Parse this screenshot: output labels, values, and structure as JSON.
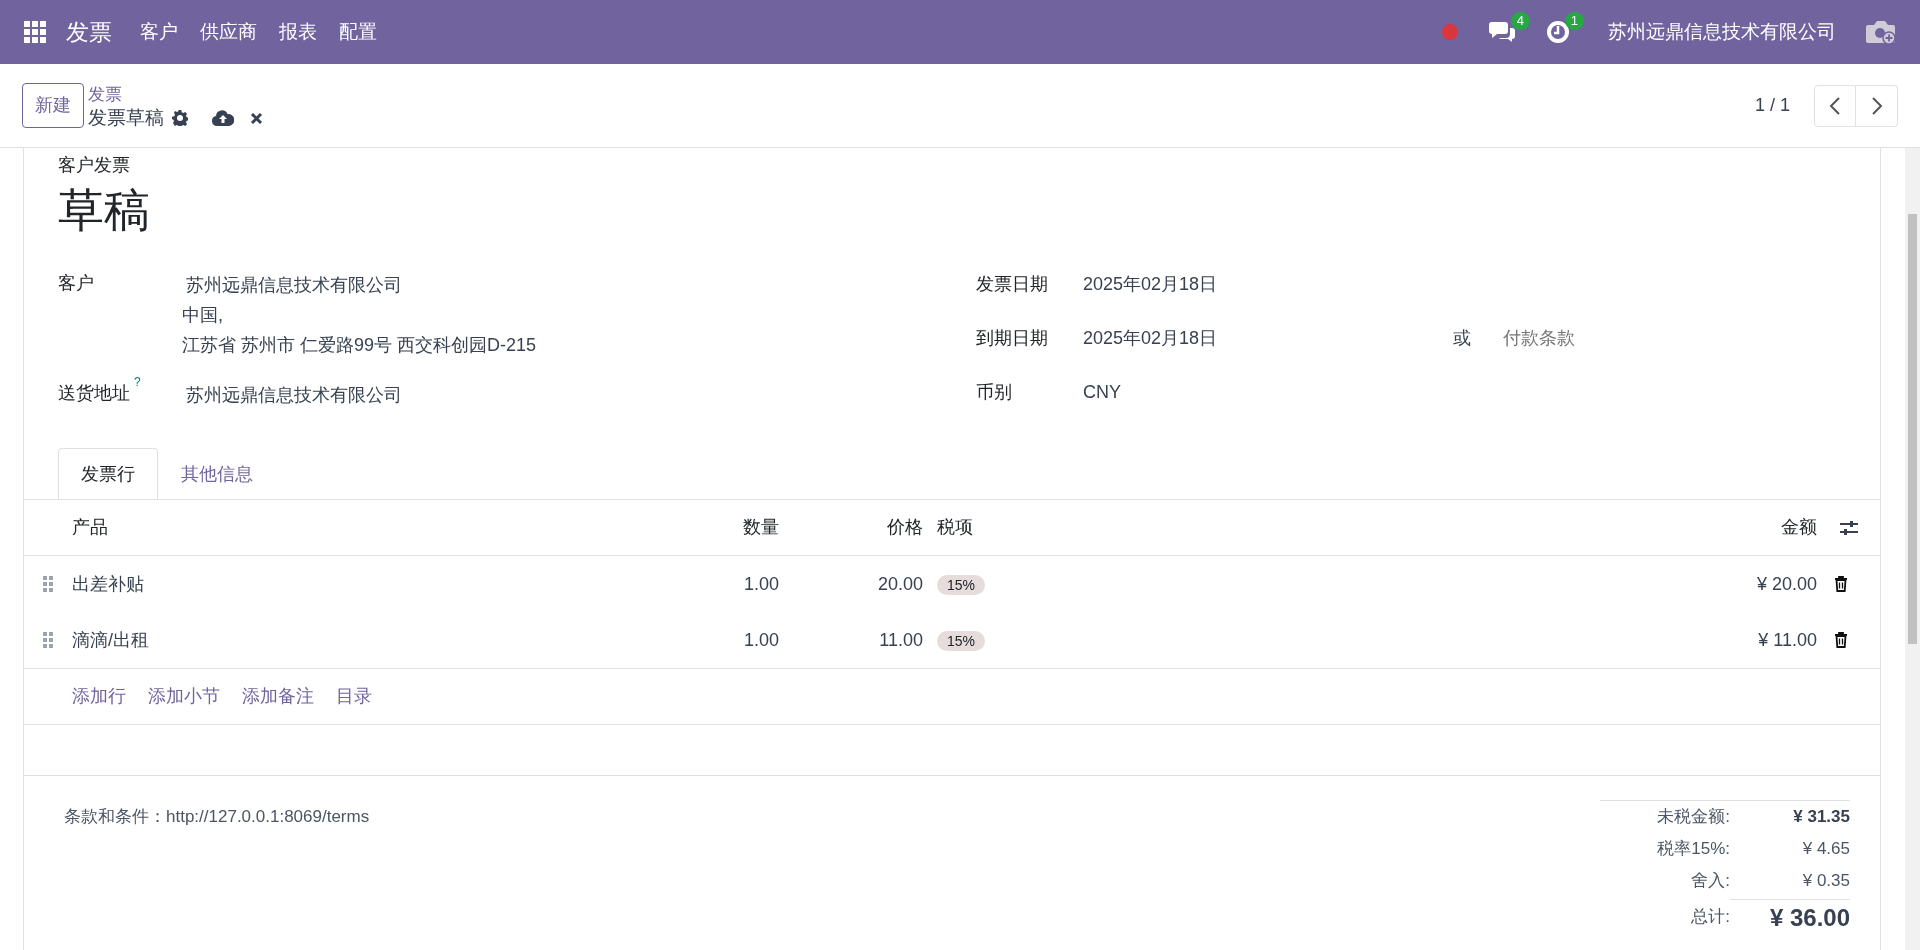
{
  "navbar": {
    "app": "发票",
    "menus": [
      "客户",
      "供应商",
      "报表",
      "配置"
    ],
    "messages_count": "4",
    "activities_count": "1",
    "company": "苏州远鼎信息技术有限公司"
  },
  "control_panel": {
    "new_button": "新建",
    "breadcrumb": "发票",
    "record": "发票草稿",
    "pager": "1 / 1"
  },
  "form": {
    "type": "客户发票",
    "title": "草稿",
    "left_fields": [
      {
        "label": "客户",
        "lines": [
          "苏州远鼎信息技术有限公司",
          "中国,",
          "江苏省 苏州市 仁爱路99号 西交科创园D-215"
        ]
      },
      {
        "label": "送货地址",
        "help": "?",
        "lines": [
          "苏州远鼎信息技术有限公司"
        ]
      }
    ],
    "right_fields": [
      {
        "label": "发票日期",
        "value": "2025年02月18日"
      },
      {
        "label": "到期日期",
        "value": "2025年02月18日",
        "or": "或",
        "placeholder": "付款条款"
      },
      {
        "label": "币别",
        "value": "CNY"
      }
    ],
    "tabs": [
      {
        "label": "发票行",
        "selected": true
      },
      {
        "label": "其他信息",
        "selected": false
      }
    ],
    "lines": {
      "columns": [
        "产品",
        "数量",
        "价格",
        "税项",
        "金额"
      ],
      "rows": [
        {
          "product": "出差补贴",
          "quantity": "1.00",
          "price": "20.00",
          "tax": "15%",
          "amount": "¥ 20.00"
        },
        {
          "product": "滴滴/出租",
          "quantity": "1.00",
          "price": "11.00",
          "tax": "15%",
          "amount": "¥ 11.00"
        }
      ],
      "add_links": [
        "添加行",
        "添加小节",
        "添加备注",
        "目录"
      ]
    },
    "terms": "条款和条件：http://127.0.0.1:8069/terms",
    "totals": [
      {
        "label": "未税金额:",
        "value": "¥ 31.35",
        "kind": "bold"
      },
      {
        "label": "税率15%:",
        "value": "¥ 4.65",
        "kind": "normal"
      },
      {
        "label": "舍入:",
        "value": "¥ 0.35",
        "kind": "normal"
      },
      {
        "label": "总计:",
        "value": "¥ 36.00",
        "kind": "grand"
      }
    ]
  }
}
